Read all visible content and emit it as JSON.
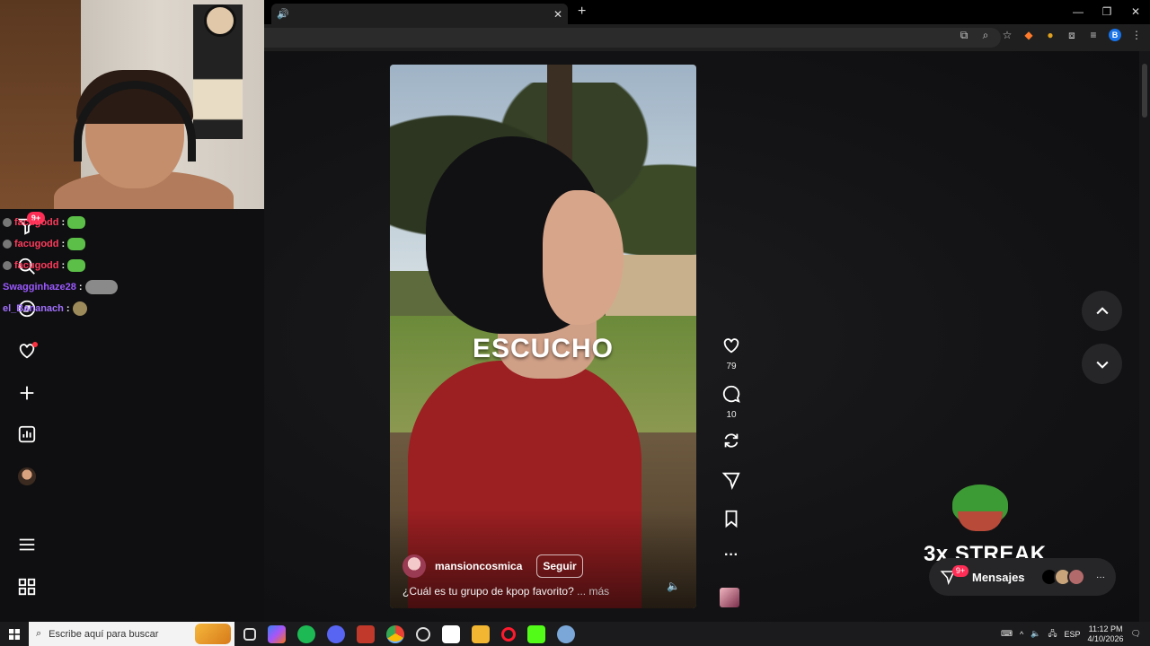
{
  "browser": {
    "tab_close": "✕",
    "new_tab": "+",
    "window_controls": [
      "—",
      "❐",
      "✕"
    ]
  },
  "chat": [
    {
      "user": "facugodd",
      "color": "#ff3b5c",
      "emote": "green"
    },
    {
      "user": "facugodd",
      "color": "#ff3b5c",
      "emote": "green"
    },
    {
      "user": "facugodd",
      "color": "#ff3b5c",
      "emote": "green"
    },
    {
      "user": "Swagginhaze28",
      "color": "#9b59ff",
      "emote": "grey"
    },
    {
      "user": "el_Bananach",
      "color": "#a270ff",
      "emote": "small"
    }
  ],
  "sidebar": {
    "notification_count": "9+"
  },
  "reel": {
    "overlay_text": "ESCUCHO",
    "author": "mansioncosmica",
    "follow_label": "Seguir",
    "caption": "¿Cuál es tu grupo de kpop favorito?",
    "more_label": "... más",
    "likes": "79",
    "comments": "10"
  },
  "streak": {
    "text": "3x STREAK"
  },
  "messages": {
    "label": "Mensajes",
    "badge": "9+",
    "more": "···"
  },
  "taskbar": {
    "search_placeholder": "Escribe aquí para buscar",
    "language": "ESP",
    "time": "11:12 PM",
    "date": "4/10/2026"
  },
  "colors": {
    "accent_red": "#ff2d55",
    "background": "#0f0f11"
  }
}
